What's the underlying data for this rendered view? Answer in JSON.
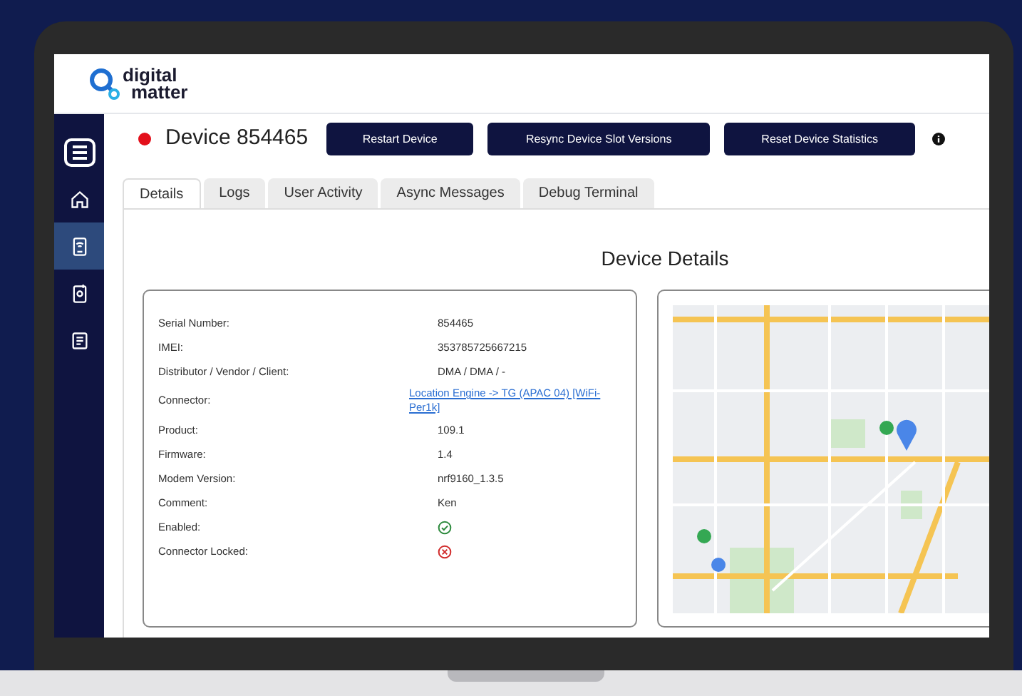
{
  "logo": {
    "line_1": "digital",
    "line_2": "matter"
  },
  "sidebar": {
    "items": [
      {
        "kind": "menu",
        "selected": false
      },
      {
        "kind": "home",
        "selected": false
      },
      {
        "kind": "device",
        "selected": true
      },
      {
        "kind": "device-settings",
        "selected": false
      },
      {
        "kind": "document",
        "selected": false
      }
    ]
  },
  "device": {
    "online": false,
    "title": "Device 854465"
  },
  "actions": [
    "Restart Device",
    "Resync Device Slot Versions",
    "Reset Device Statistics"
  ],
  "tabs": [
    {
      "label": "Details",
      "selected": true
    },
    {
      "label": "Logs",
      "selected": false
    },
    {
      "label": "User Activity",
      "selected": false
    },
    {
      "label": "Async Messages",
      "selected": false
    },
    {
      "label": "Debug Terminal",
      "selected": false
    }
  ],
  "details": {
    "heading": "Device Details",
    "fields": [
      {
        "kind": "text",
        "label": "Serial Number:",
        "value": "854465"
      },
      {
        "kind": "text",
        "label": "IMEI:",
        "value": "353785725667215"
      },
      {
        "kind": "text",
        "label": "Distributor / Vendor / Client:",
        "value": "DMA / DMA / -"
      },
      {
        "kind": "link",
        "label": "Connector:",
        "value": "Location Engine -> TG (APAC 04) [WiFi-Per1k]"
      },
      {
        "kind": "text",
        "label": "Product:",
        "value": "109.1"
      },
      {
        "kind": "text",
        "label": "Firmware:",
        "value": "1.4"
      },
      {
        "kind": "text",
        "label": "Modem Version:",
        "value": "nrf9160_1.3.5"
      },
      {
        "kind": "text",
        "label": "Comment:",
        "value": "Ken"
      },
      {
        "kind": "boolean",
        "label": "Enabled:",
        "checked": true
      },
      {
        "kind": "boolean",
        "label": "Connector Locked:",
        "checked": false
      }
    ]
  }
}
